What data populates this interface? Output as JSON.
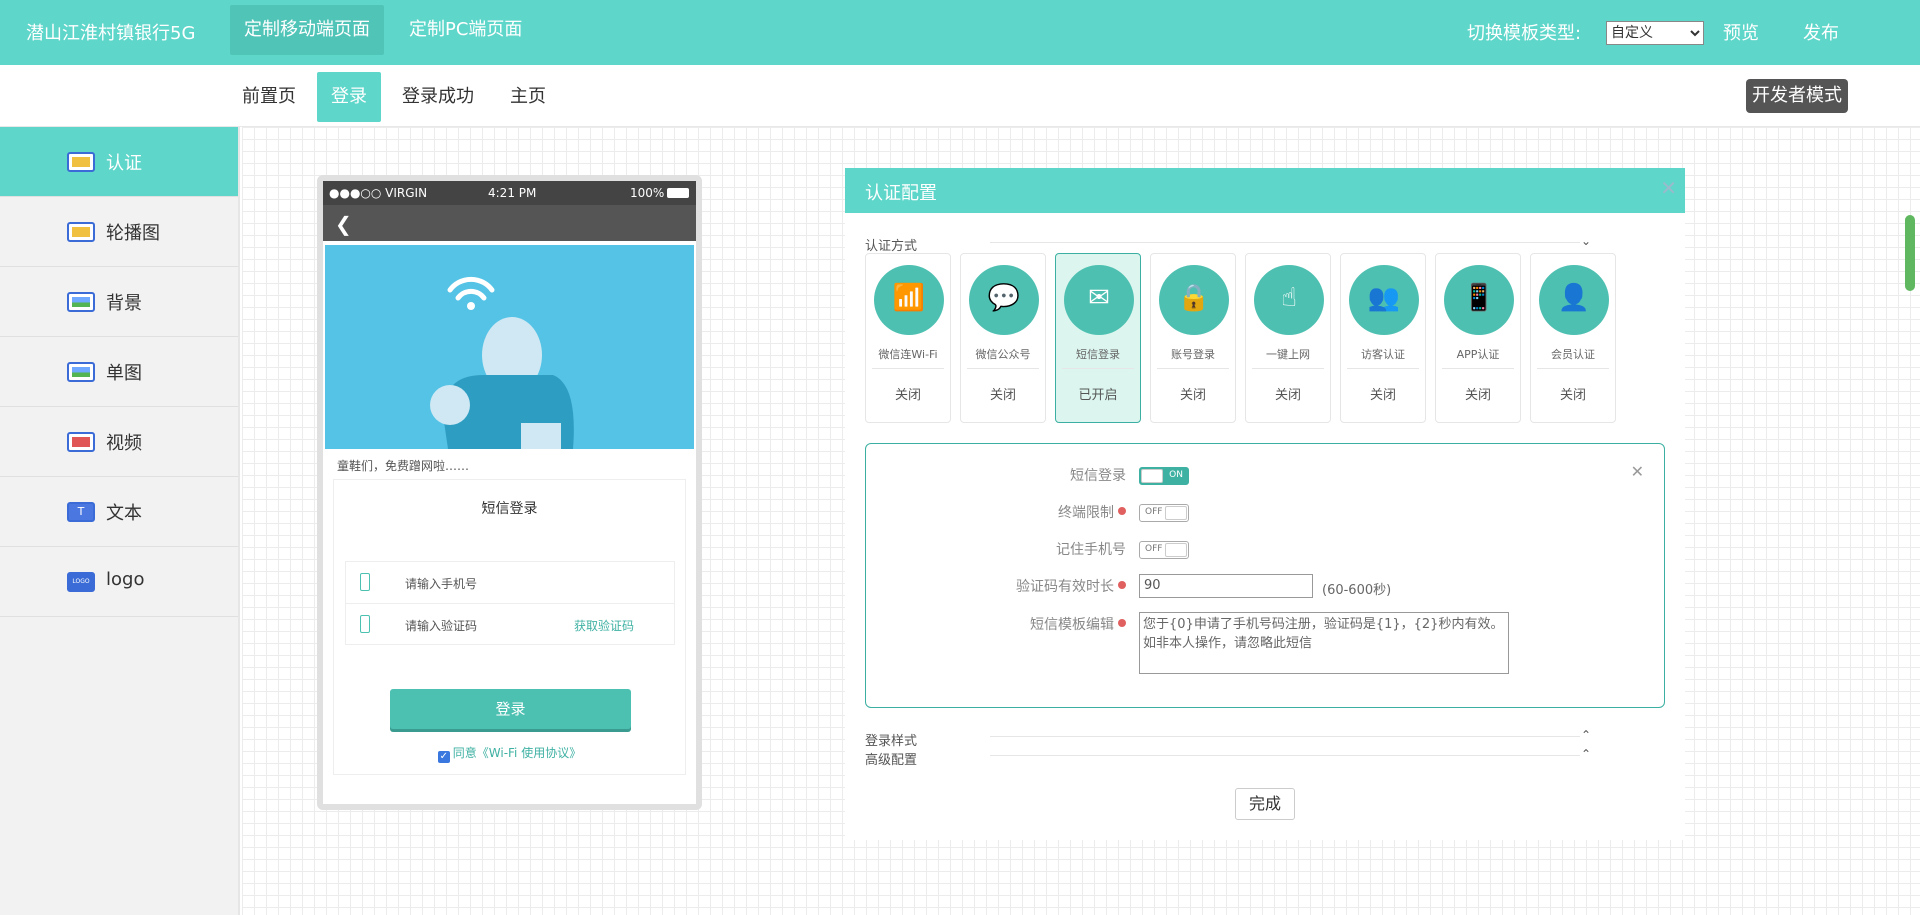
{
  "topbar": {
    "brand": "潜山江淮村镇银行5G",
    "nav": [
      "定制移动端页面",
      "定制PC端页面"
    ],
    "template_label": "切换模板类型:",
    "template_value": "自定义",
    "preview": "预览",
    "publish": "发布"
  },
  "subbar": {
    "tabs": [
      "前置页",
      "登录",
      "登录成功",
      "主页"
    ],
    "dev_mode": "开发者模式"
  },
  "sidebar": {
    "items": [
      "认证",
      "轮播图",
      "背景",
      "单图",
      "视频",
      "文本",
      "logo"
    ]
  },
  "phone": {
    "carrier": "●●●○○ VIRGIN",
    "time": "4:21 PM",
    "battery": "100%",
    "tagline": "童鞋们，免费蹭网啦……",
    "card_title": "短信登录",
    "phone_placeholder": "请输入手机号",
    "code_placeholder": "请输入验证码",
    "get_code": "获取验证码",
    "login_button": "登录",
    "agree_text": "同意《Wi-Fi 使用协议》"
  },
  "panel": {
    "title": "认证配置",
    "auth_section": "认证方式",
    "methods": [
      {
        "name": "微信连Wi-Fi",
        "status": "关闭",
        "icon": "wifi-icon"
      },
      {
        "name": "微信公众号",
        "status": "关闭",
        "icon": "wechat-icon"
      },
      {
        "name": "短信登录",
        "status": "已开启",
        "icon": "envelope-icon"
      },
      {
        "name": "账号登录",
        "status": "关闭",
        "icon": "lock-icon"
      },
      {
        "name": "一键上网",
        "status": "关闭",
        "icon": "tap-icon"
      },
      {
        "name": "访客认证",
        "status": "关闭",
        "icon": "visitors-icon"
      },
      {
        "name": "APP认证",
        "status": "关闭",
        "icon": "phone-icon"
      },
      {
        "name": "会员认证",
        "status": "关闭",
        "icon": "member-icon"
      }
    ],
    "config": {
      "sms_login_label": "短信登录",
      "sms_login_switch": "ON",
      "terminal_limit_label": "终端限制",
      "terminal_limit_switch": "OFF",
      "remember_phone_label": "记住手机号",
      "remember_phone_switch": "OFF",
      "code_valid_label": "验证码有效时长",
      "code_valid_value": "90",
      "code_valid_hint": "(60-600秒)",
      "template_label": "短信模板编辑",
      "template_text": "您于{0}申请了手机号码注册，验证码是{1}，{2}秒内有效。如非本人操作，请忽略此短信"
    },
    "login_style": "登录样式",
    "advanced": "高级配置",
    "done": "完成"
  },
  "colors": {
    "accent": "#5fd6ca",
    "accent_dark": "#4cc1b2"
  }
}
